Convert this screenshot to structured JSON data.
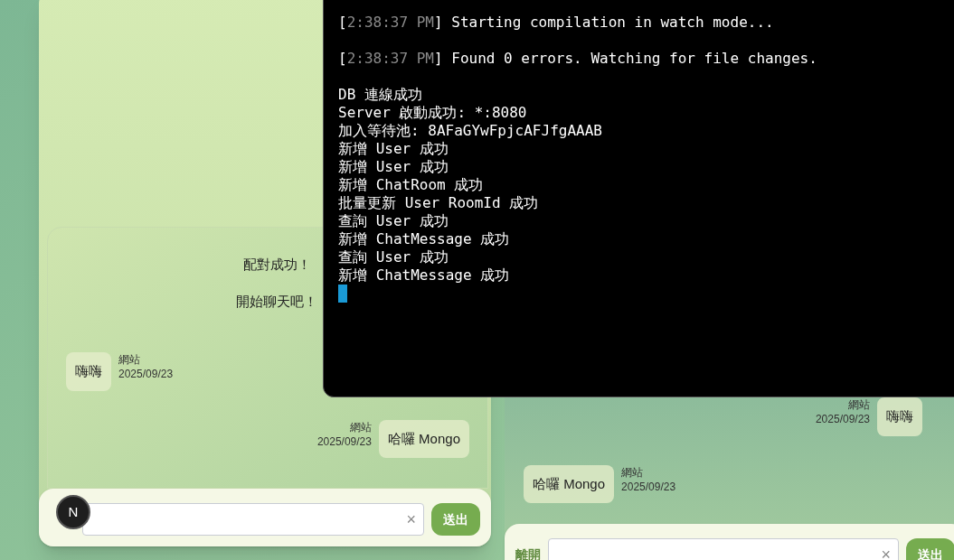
{
  "left_chat": {
    "system_messages": [
      "配對成功！",
      "開始聊天吧！"
    ],
    "messages": [
      {
        "kind": "received",
        "text": "嗨嗨",
        "sender": "網站",
        "date": "2025/09/23"
      },
      {
        "kind": "sent",
        "text": "哈囉 Mongo",
        "sender": "網站",
        "date": "2025/09/23"
      }
    ],
    "composer": {
      "clear": "×",
      "send": "送出"
    },
    "badge": "N"
  },
  "right_chat": {
    "messages": [
      {
        "kind": "sent",
        "text": "嗨嗨",
        "sender": "網站",
        "date": "2025/09/23"
      },
      {
        "kind": "received",
        "text": "哈囉 Mongo",
        "sender": "網站",
        "date": "2025/09/23"
      }
    ],
    "composer": {
      "leave_label": "離開",
      "clear": "×",
      "send": "送出"
    }
  },
  "terminal": {
    "lines": [
      {
        "kind": "timestamped",
        "open": "[",
        "time": "2:38:37 PM",
        "close": "]",
        "text": "Starting compilation in watch mode..."
      },
      {
        "kind": "timestamped",
        "open": "[",
        "time": "2:38:37 PM",
        "close": "]",
        "text": "Found 0 errors. Watching for file changes."
      },
      {
        "kind": "plain",
        "text": "DB 連線成功"
      },
      {
        "kind": "plain",
        "text": "Server 啟動成功: *:8080"
      },
      {
        "kind": "plain",
        "text": "加入等待池: 8AFaGYwFpjcAFJfgAAAB"
      },
      {
        "kind": "plain",
        "text": "新增 User 成功"
      },
      {
        "kind": "plain",
        "text": "新增 User 成功"
      },
      {
        "kind": "plain",
        "text": "新增 ChatRoom 成功"
      },
      {
        "kind": "plain",
        "text": "批量更新 User RoomId 成功"
      },
      {
        "kind": "plain",
        "text": "查詢 User 成功"
      },
      {
        "kind": "plain",
        "text": "新增 ChatMessage 成功"
      },
      {
        "kind": "plain",
        "text": "查詢 User 成功"
      },
      {
        "kind": "plain",
        "text": "新增 ChatMessage 成功"
      }
    ]
  }
}
